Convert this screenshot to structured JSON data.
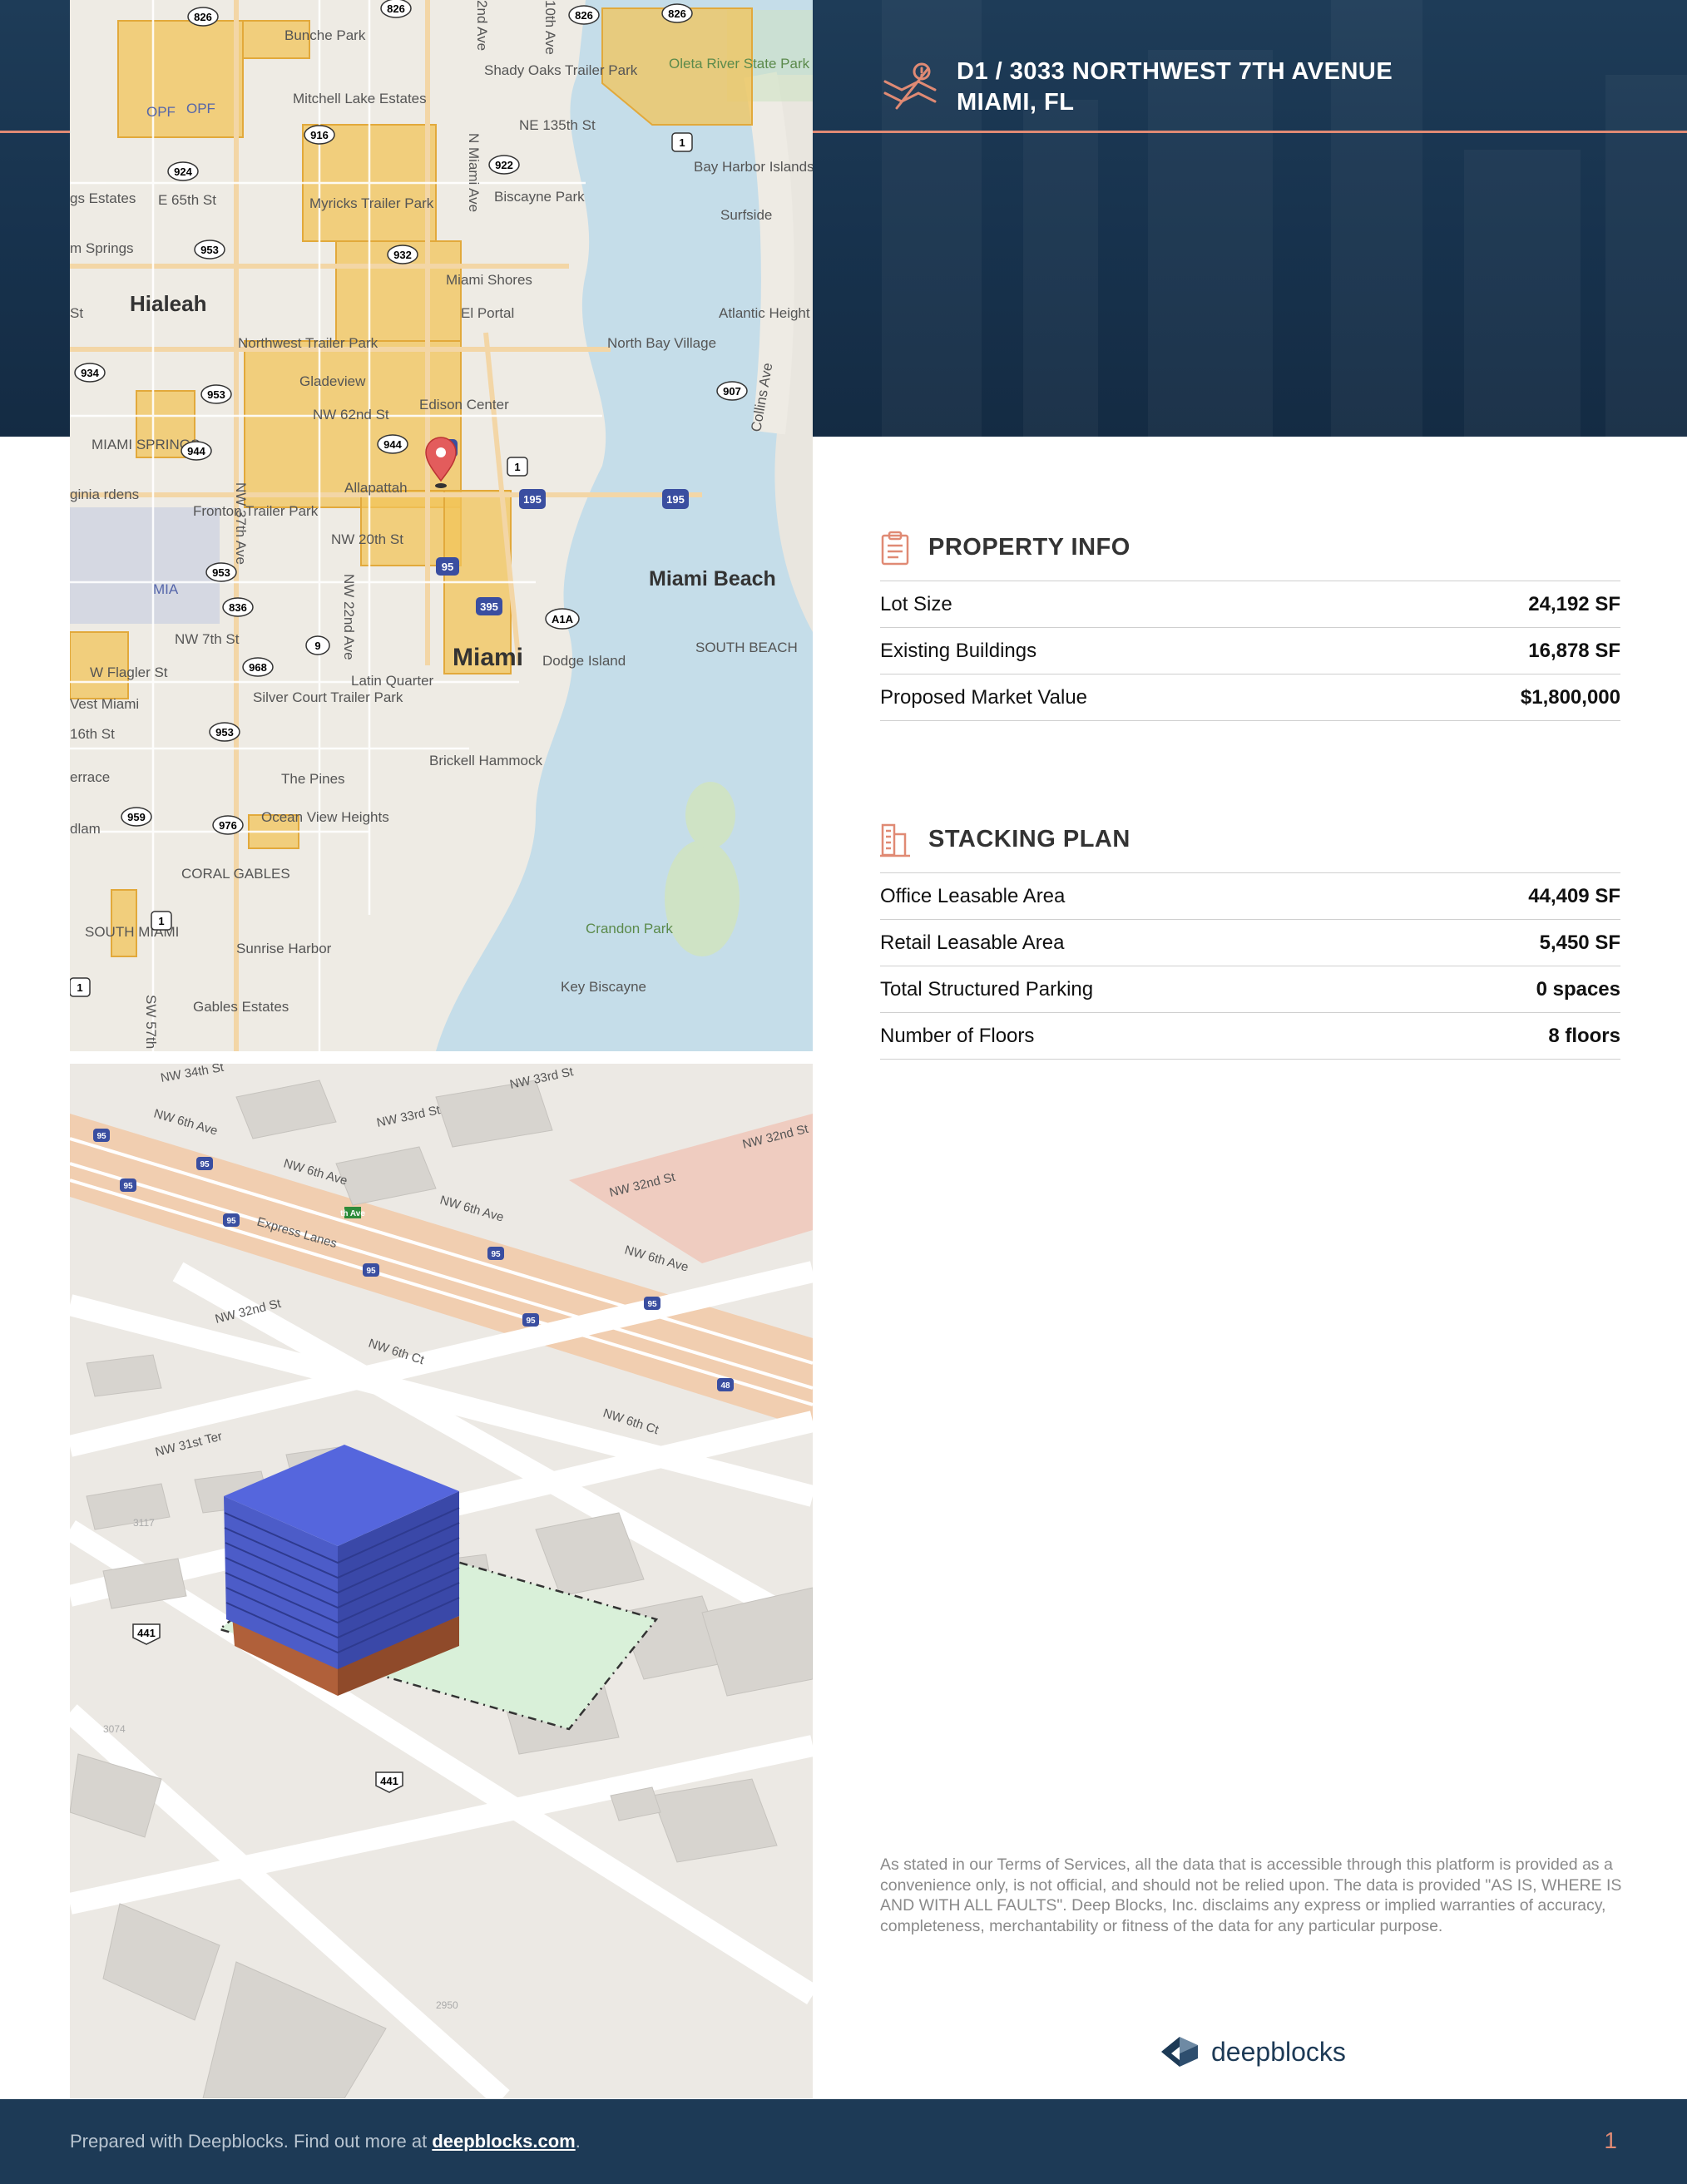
{
  "header": {
    "title_line1": "D1 / 3033 NORTHWEST 7TH AVENUE",
    "title_line2": "MIAMI, FL",
    "icon": "crossed-map-pin-icon"
  },
  "colors": {
    "navy": "#1d3a56",
    "accent": "#e08a74",
    "office_block": "#5566dd",
    "retail_block": "#b0603a",
    "lot_fill": "#d9f0d9",
    "zone_fill": "#f1c45a"
  },
  "map_labels": {
    "places": [
      "Bunche Park",
      "Mitchell Lake Estates",
      "Shady Oaks Trailer Park",
      "Oleta River State Park",
      "Bay Harbor Islands",
      "Surfside",
      "Biscayne Park",
      "Myricks Trailer Park",
      "Miami Shores",
      "El Portal",
      "Hialeah",
      "Northwest Trailer Park",
      "North Bay Village",
      "Atlantic Height",
      "Gladeview",
      "Edison Center",
      "MIAMI SPRINGS",
      "Allapattah",
      "Fronton Trailer Park",
      "Miami Beach",
      "MIA",
      "Miami",
      "Dodge Island",
      "SOUTH BEACH",
      "Latin Quarter",
      "Silver Court Trailer Park",
      "The Pines",
      "Brickell Hammock",
      "Ocean View Heights",
      "CORAL GABLES",
      "Crandon Park",
      "SOUTH MIAMI",
      "Sunrise Harbor",
      "Gables Estates",
      "Key Biscayne",
      "OPF",
      "OPF",
      "W Flagler St",
      "NW 7th St",
      "NW 20th St",
      "NW 62nd St",
      "NE 135th St",
      "E 65th St",
      "16th St",
      "Collins Ave",
      "NW 37th Ave",
      "NW 22nd Ave",
      "N Miami Ave",
      "10th Ave",
      "2nd Ave",
      "SW 57th",
      "gs Estates",
      "m Springs",
      "St",
      "ginia rdens",
      "Vest Miami",
      "errace",
      "dlam"
    ],
    "shields": [
      "826",
      "826",
      "826",
      "826",
      "916",
      "924",
      "922",
      "953",
      "932",
      "934",
      "953",
      "944",
      "944",
      "907",
      "1",
      "1",
      "1",
      "195",
      "195",
      "95",
      "95",
      "395",
      "A1A",
      "953",
      "836",
      "9",
      "968",
      "953",
      "959",
      "976",
      "1"
    ],
    "streets_3d": [
      "NW 34th St",
      "NW 33rd St",
      "NW 33rd St",
      "NW 6th Ave",
      "NW 6th Ave",
      "NW 6th Ave",
      "NW 32nd St",
      "NW 32nd St",
      "NW 6th Ave",
      "Express Lanes",
      "NW 32nd St",
      "NW 6th Ct",
      "NW 6th Ct",
      "NW 31st Ter",
      "441",
      "441",
      "2950",
      "3117",
      "3074",
      "95",
      "95",
      "95",
      "95",
      "95",
      "95",
      "95",
      "95",
      "48",
      "th Ave"
    ]
  },
  "property_info": {
    "title": "PROPERTY INFO",
    "icon": "clipboard-icon",
    "rows": [
      {
        "label": "Lot Size",
        "value": "24,192 SF"
      },
      {
        "label": "Existing Buildings",
        "value": "16,878 SF"
      },
      {
        "label": "Proposed Market Value",
        "value": "$1,800,000"
      }
    ]
  },
  "stacking_plan": {
    "title": "STACKING PLAN",
    "icon": "building-icon",
    "rows": [
      {
        "label": "Office Leasable Area",
        "value": "44,409 SF"
      },
      {
        "label": "Retail Leasable Area",
        "value": "5,450 SF"
      },
      {
        "label": "Total Structured Parking",
        "value": "0 spaces"
      },
      {
        "label": "Number of Floors",
        "value": "8 floors"
      }
    ]
  },
  "disclaimer": "As stated in our Terms of Services, all the data that is accessible through this platform is provided as a convenience only, is not official, and should not be relied upon. The data is provided \"AS IS, WHERE IS AND WITH ALL FAULTS\". Deep Blocks, Inc. disclaims any express or implied warranties of accuracy, completeness, merchantability or fitness of the data for any particular purpose.",
  "logo": {
    "text": "deepblocks",
    "icon": "deepblocks-logo-icon"
  },
  "footer": {
    "prefix": "Prepared with Deepblocks. Find out more at ",
    "link": "deepblocks.com",
    "suffix": ".",
    "page_number": "1"
  }
}
